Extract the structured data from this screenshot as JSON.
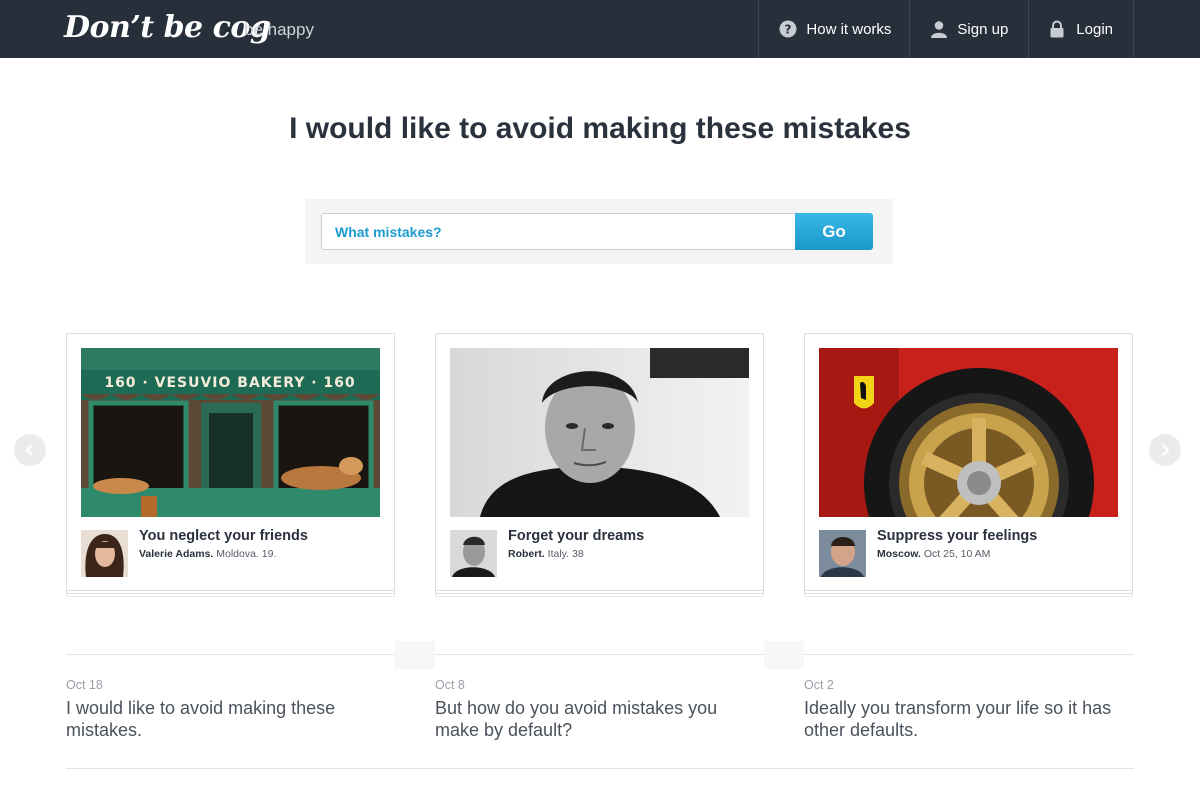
{
  "nav": {
    "logo": "Don’t be cog",
    "tagline": "be happy",
    "items": [
      {
        "label": "How it works",
        "icon": "question-icon"
      },
      {
        "label": "Sign up",
        "icon": "user-icon"
      },
      {
        "label": "Login",
        "icon": "lock-icon"
      }
    ]
  },
  "headline": "I would like to avoid making these mistakes",
  "search": {
    "placeholder": "What mistakes?",
    "button": "Go"
  },
  "cards": [
    {
      "title": "You neglect your friends",
      "author": "Valerie Adams.",
      "meta": " Moldova. 19.",
      "sign_text": "160 · VESUVIO BAKERY · 160"
    },
    {
      "title": "Forget your dreams",
      "author": "Robert.",
      "meta": " Italy. 38"
    },
    {
      "title": "Suppress your feelings",
      "author": "Moscow.",
      "meta": " Oct 25, 10 AM"
    }
  ],
  "posts": [
    {
      "date": "Oct 18",
      "text": "I would like to avoid making these mistakes."
    },
    {
      "date": "Oct 8",
      "text": "But how do you avoid mistakes you make by default?"
    },
    {
      "date": "Oct 2",
      "text": "Ideally you transform your life so it has other defaults."
    }
  ],
  "colors": {
    "nav_bg": "#272f3b",
    "accent": "#1b9bd0",
    "button": "#2aa9d9"
  }
}
